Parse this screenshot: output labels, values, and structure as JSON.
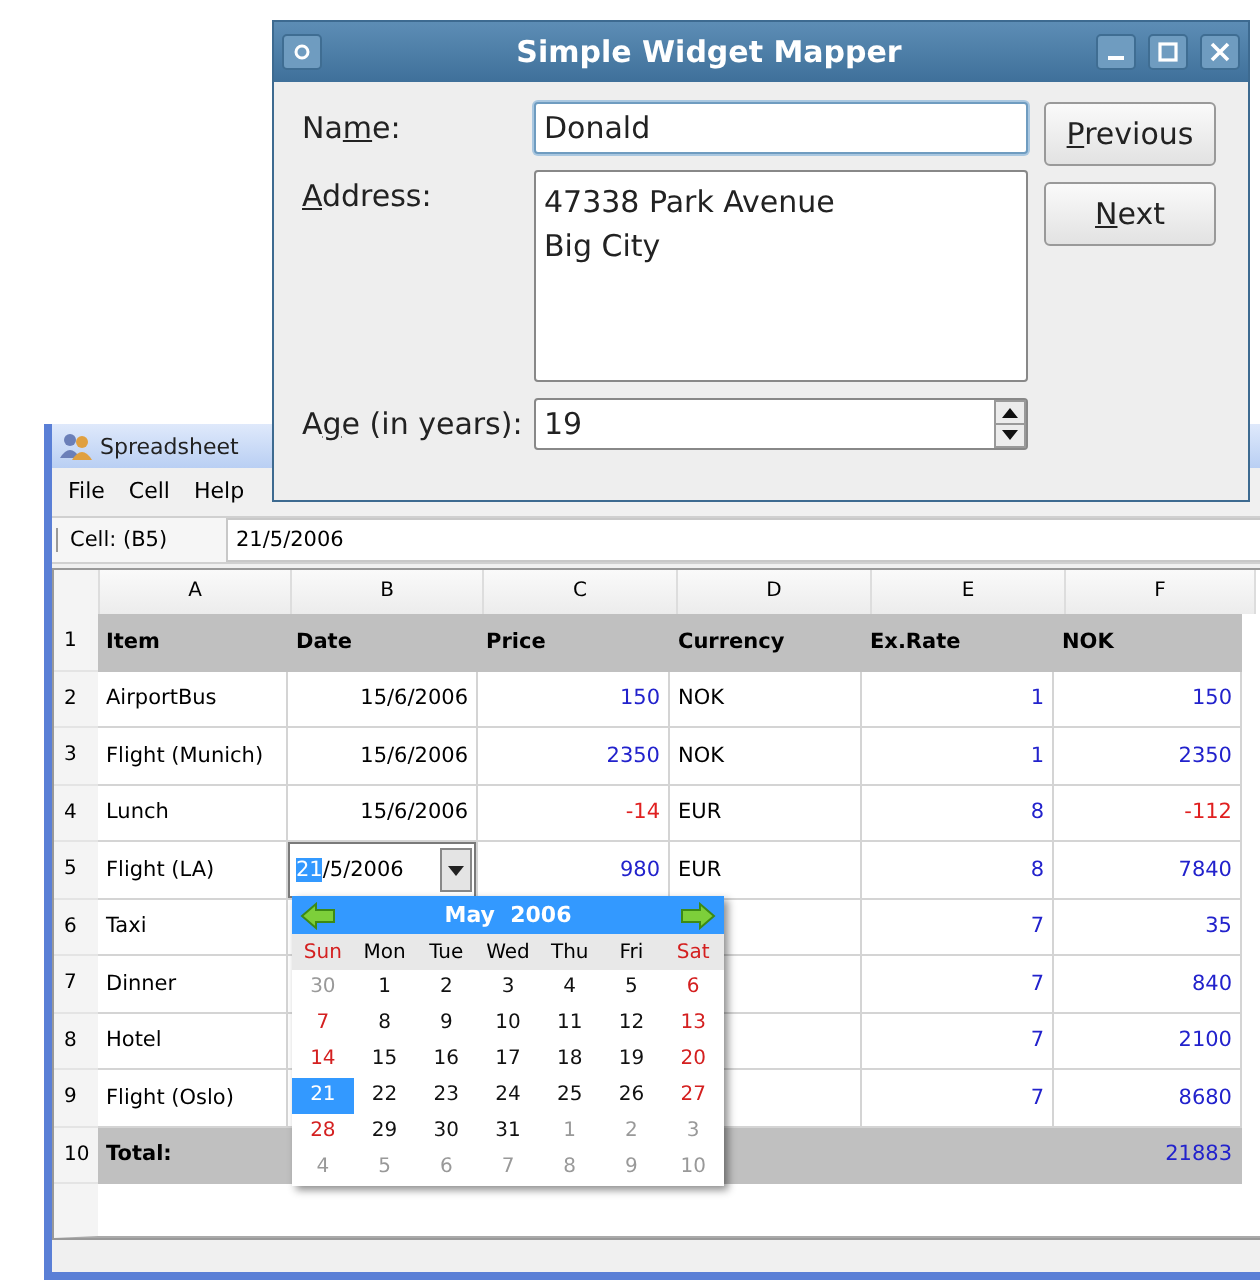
{
  "spreadsheet": {
    "title": "Spreadsheet",
    "menu": [
      "File",
      "Cell",
      "Help"
    ],
    "formula_bar": {
      "cell_label": "Cell: (B5)",
      "value": "21/5/2006"
    },
    "columns": [
      "A",
      "B",
      "C",
      "D",
      "E",
      "F"
    ],
    "rows": [
      {
        "label": "1",
        "kind": "heading",
        "cells": [
          {
            "kind": "head",
            "text": "Item"
          },
          {
            "kind": "head",
            "text": "Date"
          },
          {
            "kind": "head",
            "text": "Price"
          },
          {
            "kind": "head",
            "text": "Currency"
          },
          {
            "kind": "head",
            "text": "Ex.Rate"
          },
          {
            "kind": "head",
            "text": "NOK"
          }
        ]
      },
      {
        "label": "2",
        "kind": "data",
        "cells": [
          {
            "kind": "text",
            "text": "AirportBus"
          },
          {
            "kind": "date",
            "text": "15/6/2006"
          },
          {
            "kind": "num",
            "text": "150"
          },
          {
            "kind": "text",
            "text": "NOK"
          },
          {
            "kind": "num",
            "text": "1"
          },
          {
            "kind": "num",
            "text": "150"
          }
        ]
      },
      {
        "label": "3",
        "kind": "data",
        "cells": [
          {
            "kind": "text",
            "text": "Flight (Munich)"
          },
          {
            "kind": "date",
            "text": "15/6/2006"
          },
          {
            "kind": "num",
            "text": "2350"
          },
          {
            "kind": "text",
            "text": "NOK"
          },
          {
            "kind": "num",
            "text": "1"
          },
          {
            "kind": "num",
            "text": "2350"
          }
        ]
      },
      {
        "label": "4",
        "kind": "data",
        "cells": [
          {
            "kind": "text",
            "text": "Lunch"
          },
          {
            "kind": "date",
            "text": "15/6/2006"
          },
          {
            "kind": "neg",
            "text": "-14"
          },
          {
            "kind": "text",
            "text": "EUR"
          },
          {
            "kind": "num",
            "text": "8"
          },
          {
            "kind": "neg",
            "text": "-112"
          }
        ]
      },
      {
        "label": "5",
        "kind": "data",
        "cells": [
          {
            "kind": "text",
            "text": "Flight (LA)"
          },
          {
            "kind": "editor",
            "selected_text": "21",
            "text": "/5/2006"
          },
          {
            "kind": "num",
            "text": "980"
          },
          {
            "kind": "text",
            "text": "EUR"
          },
          {
            "kind": "num",
            "text": "8"
          },
          {
            "kind": "num",
            "text": "7840"
          }
        ]
      },
      {
        "label": "6",
        "kind": "data",
        "cells": [
          {
            "kind": "text",
            "text": "Taxi"
          },
          null,
          null,
          null,
          {
            "kind": "num",
            "text": "7"
          },
          {
            "kind": "num",
            "text": "35"
          }
        ]
      },
      {
        "label": "7",
        "kind": "data",
        "cells": [
          {
            "kind": "text",
            "text": "Dinner"
          },
          null,
          null,
          null,
          {
            "kind": "num",
            "text": "7"
          },
          {
            "kind": "num",
            "text": "840"
          }
        ]
      },
      {
        "label": "8",
        "kind": "data",
        "cells": [
          {
            "kind": "text",
            "text": "Hotel"
          },
          null,
          null,
          null,
          {
            "kind": "num",
            "text": "7"
          },
          {
            "kind": "num",
            "text": "2100"
          }
        ]
      },
      {
        "label": "9",
        "kind": "data",
        "cells": [
          {
            "kind": "text",
            "text": "Flight (Oslo)"
          },
          null,
          null,
          null,
          {
            "kind": "num",
            "text": "7"
          },
          {
            "kind": "num",
            "text": "8680"
          }
        ]
      },
      {
        "label": "10",
        "kind": "total",
        "cells": [
          {
            "kind": "head",
            "text": "Total:"
          },
          null,
          null,
          null,
          null,
          {
            "kind": "num",
            "text": "21883"
          }
        ]
      }
    ]
  },
  "calendar": {
    "title": "May  2006",
    "weekdays": [
      {
        "label": "Sun",
        "weekend": true
      },
      {
        "label": "Mon",
        "weekend": false
      },
      {
        "label": "Tue",
        "weekend": false
      },
      {
        "label": "Wed",
        "weekend": false
      },
      {
        "label": "Thu",
        "weekend": false
      },
      {
        "label": "Fri",
        "weekend": false
      },
      {
        "label": "Sat",
        "weekend": true
      }
    ],
    "weeks": [
      [
        {
          "day": "30",
          "in_month": false,
          "selected": false
        },
        {
          "day": "1",
          "in_month": true,
          "selected": false
        },
        {
          "day": "2",
          "in_month": true,
          "selected": false
        },
        {
          "day": "3",
          "in_month": true,
          "selected": false
        },
        {
          "day": "4",
          "in_month": true,
          "selected": false
        },
        {
          "day": "5",
          "in_month": true,
          "selected": false
        },
        {
          "day": "6",
          "in_month": true,
          "selected": false
        }
      ],
      [
        {
          "day": "7",
          "in_month": true,
          "selected": false
        },
        {
          "day": "8",
          "in_month": true,
          "selected": false
        },
        {
          "day": "9",
          "in_month": true,
          "selected": false
        },
        {
          "day": "10",
          "in_month": true,
          "selected": false
        },
        {
          "day": "11",
          "in_month": true,
          "selected": false
        },
        {
          "day": "12",
          "in_month": true,
          "selected": false
        },
        {
          "day": "13",
          "in_month": true,
          "selected": false
        }
      ],
      [
        {
          "day": "14",
          "in_month": true,
          "selected": false
        },
        {
          "day": "15",
          "in_month": true,
          "selected": false
        },
        {
          "day": "16",
          "in_month": true,
          "selected": false
        },
        {
          "day": "17",
          "in_month": true,
          "selected": false
        },
        {
          "day": "18",
          "in_month": true,
          "selected": false
        },
        {
          "day": "19",
          "in_month": true,
          "selected": false
        },
        {
          "day": "20",
          "in_month": true,
          "selected": false
        }
      ],
      [
        {
          "day": "21",
          "in_month": true,
          "selected": true
        },
        {
          "day": "22",
          "in_month": true,
          "selected": false
        },
        {
          "day": "23",
          "in_month": true,
          "selected": false
        },
        {
          "day": "24",
          "in_month": true,
          "selected": false
        },
        {
          "day": "25",
          "in_month": true,
          "selected": false
        },
        {
          "day": "26",
          "in_month": true,
          "selected": false
        },
        {
          "day": "27",
          "in_month": true,
          "selected": false
        }
      ],
      [
        {
          "day": "28",
          "in_month": true,
          "selected": false
        },
        {
          "day": "29",
          "in_month": true,
          "selected": false
        },
        {
          "day": "30",
          "in_month": true,
          "selected": false
        },
        {
          "day": "31",
          "in_month": true,
          "selected": false
        },
        {
          "day": "1",
          "in_month": false,
          "selected": false
        },
        {
          "day": "2",
          "in_month": false,
          "selected": false
        },
        {
          "day": "3",
          "in_month": false,
          "selected": false
        }
      ],
      [
        {
          "day": "4",
          "in_month": false,
          "selected": false
        },
        {
          "day": "5",
          "in_month": false,
          "selected": false
        },
        {
          "day": "6",
          "in_month": false,
          "selected": false
        },
        {
          "day": "7",
          "in_month": false,
          "selected": false
        },
        {
          "day": "8",
          "in_month": false,
          "selected": false
        },
        {
          "day": "9",
          "in_month": false,
          "selected": false
        },
        {
          "day": "10",
          "in_month": false,
          "selected": false
        }
      ]
    ]
  },
  "mapper": {
    "title": "Simple Widget Mapper",
    "name": {
      "label_before": "Na",
      "mnemonic": "m",
      "label_after": "e:",
      "value": "Donald"
    },
    "address": {
      "mnemonic": "A",
      "label_after": "ddress:",
      "lines": [
        "47338 Park Avenue",
        "Big City"
      ]
    },
    "age": {
      "label_before": "A",
      "mnemonic": "g",
      "label_after": "e (in years):",
      "value": "19"
    },
    "buttons": [
      {
        "mnemonic": "P",
        "label_after": "revious"
      },
      {
        "mnemonic": "N",
        "label_after": "ext"
      }
    ]
  }
}
